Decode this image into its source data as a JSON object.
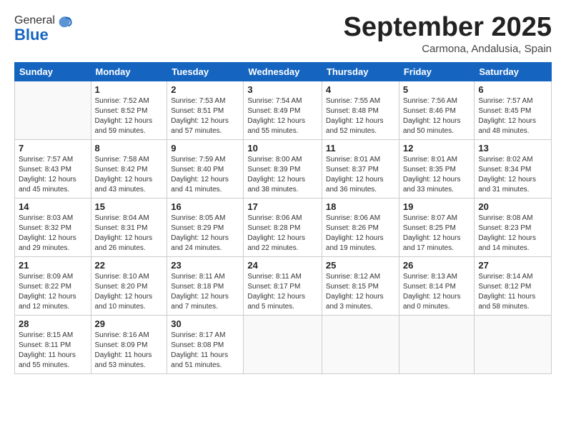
{
  "logo": {
    "general": "General",
    "blue": "Blue"
  },
  "header": {
    "month": "September 2025",
    "location": "Carmona, Andalusia, Spain"
  },
  "weekdays": [
    "Sunday",
    "Monday",
    "Tuesday",
    "Wednesday",
    "Thursday",
    "Friday",
    "Saturday"
  ],
  "weeks": [
    [
      {
        "day": "",
        "info": ""
      },
      {
        "day": "1",
        "info": "Sunrise: 7:52 AM\nSunset: 8:52 PM\nDaylight: 12 hours\nand 59 minutes."
      },
      {
        "day": "2",
        "info": "Sunrise: 7:53 AM\nSunset: 8:51 PM\nDaylight: 12 hours\nand 57 minutes."
      },
      {
        "day": "3",
        "info": "Sunrise: 7:54 AM\nSunset: 8:49 PM\nDaylight: 12 hours\nand 55 minutes."
      },
      {
        "day": "4",
        "info": "Sunrise: 7:55 AM\nSunset: 8:48 PM\nDaylight: 12 hours\nand 52 minutes."
      },
      {
        "day": "5",
        "info": "Sunrise: 7:56 AM\nSunset: 8:46 PM\nDaylight: 12 hours\nand 50 minutes."
      },
      {
        "day": "6",
        "info": "Sunrise: 7:57 AM\nSunset: 8:45 PM\nDaylight: 12 hours\nand 48 minutes."
      }
    ],
    [
      {
        "day": "7",
        "info": "Sunrise: 7:57 AM\nSunset: 8:43 PM\nDaylight: 12 hours\nand 45 minutes."
      },
      {
        "day": "8",
        "info": "Sunrise: 7:58 AM\nSunset: 8:42 PM\nDaylight: 12 hours\nand 43 minutes."
      },
      {
        "day": "9",
        "info": "Sunrise: 7:59 AM\nSunset: 8:40 PM\nDaylight: 12 hours\nand 41 minutes."
      },
      {
        "day": "10",
        "info": "Sunrise: 8:00 AM\nSunset: 8:39 PM\nDaylight: 12 hours\nand 38 minutes."
      },
      {
        "day": "11",
        "info": "Sunrise: 8:01 AM\nSunset: 8:37 PM\nDaylight: 12 hours\nand 36 minutes."
      },
      {
        "day": "12",
        "info": "Sunrise: 8:01 AM\nSunset: 8:35 PM\nDaylight: 12 hours\nand 33 minutes."
      },
      {
        "day": "13",
        "info": "Sunrise: 8:02 AM\nSunset: 8:34 PM\nDaylight: 12 hours\nand 31 minutes."
      }
    ],
    [
      {
        "day": "14",
        "info": "Sunrise: 8:03 AM\nSunset: 8:32 PM\nDaylight: 12 hours\nand 29 minutes."
      },
      {
        "day": "15",
        "info": "Sunrise: 8:04 AM\nSunset: 8:31 PM\nDaylight: 12 hours\nand 26 minutes."
      },
      {
        "day": "16",
        "info": "Sunrise: 8:05 AM\nSunset: 8:29 PM\nDaylight: 12 hours\nand 24 minutes."
      },
      {
        "day": "17",
        "info": "Sunrise: 8:06 AM\nSunset: 8:28 PM\nDaylight: 12 hours\nand 22 minutes."
      },
      {
        "day": "18",
        "info": "Sunrise: 8:06 AM\nSunset: 8:26 PM\nDaylight: 12 hours\nand 19 minutes."
      },
      {
        "day": "19",
        "info": "Sunrise: 8:07 AM\nSunset: 8:25 PM\nDaylight: 12 hours\nand 17 minutes."
      },
      {
        "day": "20",
        "info": "Sunrise: 8:08 AM\nSunset: 8:23 PM\nDaylight: 12 hours\nand 14 minutes."
      }
    ],
    [
      {
        "day": "21",
        "info": "Sunrise: 8:09 AM\nSunset: 8:22 PM\nDaylight: 12 hours\nand 12 minutes."
      },
      {
        "day": "22",
        "info": "Sunrise: 8:10 AM\nSunset: 8:20 PM\nDaylight: 12 hours\nand 10 minutes."
      },
      {
        "day": "23",
        "info": "Sunrise: 8:11 AM\nSunset: 8:18 PM\nDaylight: 12 hours\nand 7 minutes."
      },
      {
        "day": "24",
        "info": "Sunrise: 8:11 AM\nSunset: 8:17 PM\nDaylight: 12 hours\nand 5 minutes."
      },
      {
        "day": "25",
        "info": "Sunrise: 8:12 AM\nSunset: 8:15 PM\nDaylight: 12 hours\nand 3 minutes."
      },
      {
        "day": "26",
        "info": "Sunrise: 8:13 AM\nSunset: 8:14 PM\nDaylight: 12 hours\nand 0 minutes."
      },
      {
        "day": "27",
        "info": "Sunrise: 8:14 AM\nSunset: 8:12 PM\nDaylight: 11 hours\nand 58 minutes."
      }
    ],
    [
      {
        "day": "28",
        "info": "Sunrise: 8:15 AM\nSunset: 8:11 PM\nDaylight: 11 hours\nand 55 minutes."
      },
      {
        "day": "29",
        "info": "Sunrise: 8:16 AM\nSunset: 8:09 PM\nDaylight: 11 hours\nand 53 minutes."
      },
      {
        "day": "30",
        "info": "Sunrise: 8:17 AM\nSunset: 8:08 PM\nDaylight: 11 hours\nand 51 minutes."
      },
      {
        "day": "",
        "info": ""
      },
      {
        "day": "",
        "info": ""
      },
      {
        "day": "",
        "info": ""
      },
      {
        "day": "",
        "info": ""
      }
    ]
  ]
}
